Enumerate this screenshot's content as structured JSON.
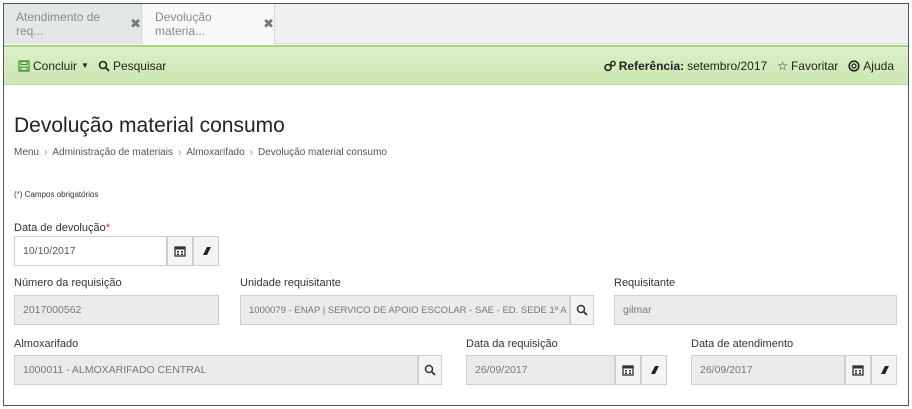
{
  "tabs": [
    {
      "label": "Atendimento de req...",
      "close": "✖"
    },
    {
      "label": "Devolução materia...",
      "close": "✖"
    }
  ],
  "toolbar": {
    "concluir": "Concluir",
    "pesquisar": "Pesquisar",
    "referencia_label": "Referência:",
    "referencia_value": "setembro/2017",
    "favoritar": "Favoritar",
    "ajuda": "Ajuda"
  },
  "page": {
    "title": "Devolução material consumo",
    "breadcrumb": [
      "Menu",
      "Administração de materiais",
      "Almoxarifado",
      "Devolução material consumo"
    ],
    "required_note_prefix": "(",
    "required_note_star": "*",
    "required_note_suffix": ") Campos obrigatórios"
  },
  "form": {
    "data_devolucao": {
      "label": "Data de devolução",
      "required": "*",
      "value": "10/10/2017"
    },
    "numero_requisicao": {
      "label": "Número da requisição",
      "value": "2017000562"
    },
    "unidade_requisitante": {
      "label": "Unidade requisitante",
      "value": "1000079 - ENAP | SERVICO DE APOIO ESCOLAR - SAE - ED. SEDE 1º A"
    },
    "requisitante": {
      "label": "Requisitante",
      "value": "gilmar"
    },
    "almoxarifado": {
      "label": "Almoxarifado",
      "value": "1000011 - ALMOXARIFADO CENTRAL"
    },
    "data_requisicao": {
      "label": "Data da requisição",
      "value": "26/09/2017"
    },
    "data_atendimento": {
      "label": "Data de atendimento",
      "value": "26/09/2017"
    }
  },
  "icons": {
    "calendar": "calendar-icon",
    "eraser": "eraser-icon",
    "search": "search-icon"
  },
  "colors": {
    "toolbar_bg": "#d3eabc",
    "toolbar_border": "#a9d37d",
    "required": "#d2322d"
  }
}
